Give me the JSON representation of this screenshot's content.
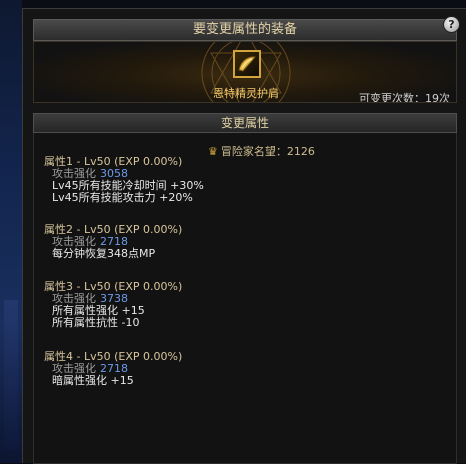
{
  "window": {
    "title": "要变更属性的装备",
    "help": "?"
  },
  "equipment": {
    "name": "恩特精灵护肩",
    "change_count_label": "可变更次数：19次"
  },
  "section": {
    "title": "变更属性"
  },
  "fame": {
    "label": "冒险家名望：2126"
  },
  "attributes": [
    {
      "title": "属性1 - Lv50 (EXP 0.00%)",
      "key_label": "攻击强化",
      "key_value": "3058",
      "lines": [
        "Lv45所有技能冷却时间 +30%",
        "Lv45所有技能攻击力 +20%"
      ]
    },
    {
      "title": "属性2 - Lv50 (EXP 0.00%)",
      "key_label": "攻击强化",
      "key_value": "2718",
      "lines": [
        "每分钟恢复348点MP"
      ]
    },
    {
      "title": "属性3 - Lv50 (EXP 0.00%)",
      "key_label": "攻击强化",
      "key_value": "3738",
      "lines": [
        "所有属性强化 +15",
        "所有属性抗性 -10"
      ]
    },
    {
      "title": "属性4 - Lv50 (EXP 0.00%)",
      "key_label": "攻击强化",
      "key_value": "2718",
      "lines": [
        "暗属性强化 +15"
      ]
    }
  ],
  "colors": {
    "title_text": "#e3d3a8",
    "item_name": "#f4c96a",
    "value_blue": "#6b9be6",
    "slot_border": "#d1a43d"
  },
  "icons": [
    "help-icon",
    "shoulder-armor-icon",
    "fame-icon"
  ]
}
